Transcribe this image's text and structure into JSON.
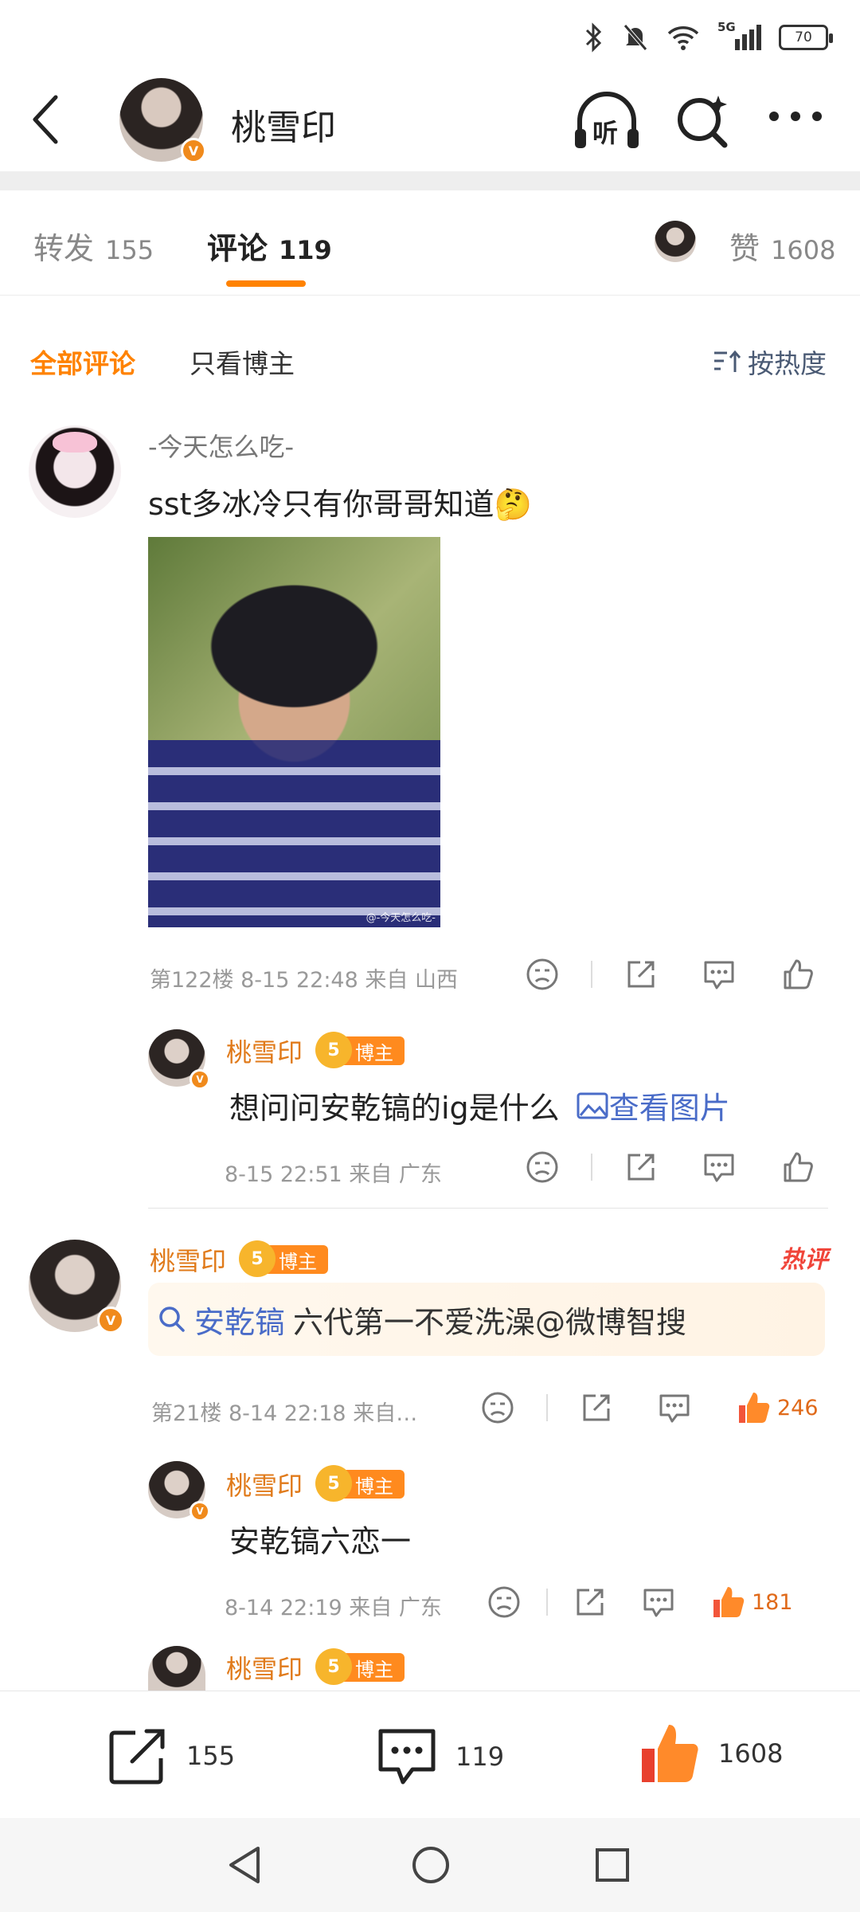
{
  "status_bar": {
    "network": "5G",
    "battery": "70"
  },
  "header": {
    "name": "桃雪印",
    "v_badge": "V",
    "listen_label": "听"
  },
  "tabs": [
    {
      "label": "转发",
      "count": "155"
    },
    {
      "label": "评论",
      "count": "119"
    },
    {
      "label": "赞",
      "count": "1608"
    }
  ],
  "filter": {
    "all": "全部评论",
    "host_only": "只看博主",
    "sort": "按热度"
  },
  "comments": [
    {
      "user": "-今天怎么吃-",
      "text": "sst多冰冷只有你哥哥知道🤔",
      "image_watermark": "@-今天怎么吃-",
      "meta": "第122楼 8-15 22:48 来自 山西",
      "reply": {
        "user": "桃雪印",
        "badge": "博主",
        "badge_level": "5",
        "text": "想问问安乾镐的ig是什么",
        "link_text": "查看图片",
        "meta": "8-15 22:51 来自 广东"
      }
    },
    {
      "user": "桃雪印",
      "badge": "博主",
      "badge_level": "5",
      "hot_tag": "热评",
      "search_link": "安乾镐",
      "search_text": "六代第一不爱洗澡@微博智搜",
      "meta": "第21楼 8-14 22:18 来自…",
      "like_count": "246",
      "replies": [
        {
          "user": "桃雪印",
          "badge": "博主",
          "badge_level": "5",
          "text": "安乾镐六恋一",
          "meta": "8-14 22:19 来自 广东",
          "like_count": "181"
        },
        {
          "user": "桃雪印",
          "badge": "博主",
          "badge_level": "5"
        }
      ]
    }
  ],
  "bottom_bar": {
    "repost": "155",
    "comment": "119",
    "like": "1608"
  }
}
